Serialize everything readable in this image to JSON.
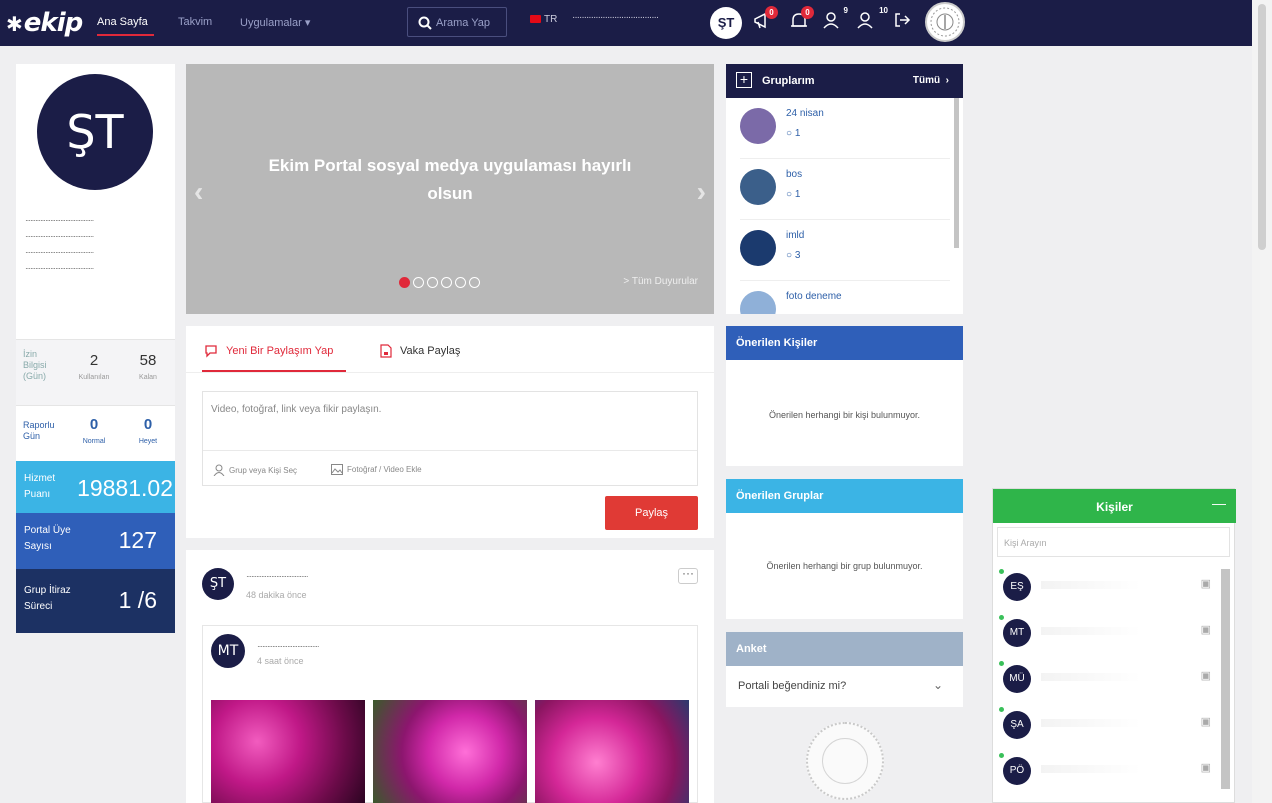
{
  "app": {
    "logo": "ekip"
  },
  "nav": {
    "home": "Ana Sayfa",
    "calendar": "Takvim",
    "apps": "Uygulamalar",
    "search_label": "Arama Yap",
    "lang": "TR",
    "user_masked": "·····································",
    "user_initials": "ŞT",
    "badges": {
      "announcements": "0",
      "notifications": "0",
      "friend_requests": "9",
      "group_requests": "10"
    }
  },
  "profile": {
    "initials": "ŞT",
    "masked_lines": [
      "·········································",
      "·········································",
      "·········································",
      "·········································"
    ],
    "leave": {
      "label": "İzin Bilgisi (Gün)",
      "used_value": "2",
      "used_label": "Kullanılan",
      "remaining_value": "58",
      "remaining_label": "Kalan"
    },
    "report": {
      "label": "Raporlu Gün",
      "normal_value": "0",
      "normal_label": "Normal",
      "committee_value": "0",
      "committee_label": "Heyet"
    },
    "service": {
      "label": "Hizmet Puanı",
      "value": "19881.02"
    },
    "members": {
      "label": "Portal Üye Sayısı",
      "value": "127"
    },
    "objection": {
      "label": "Grup İtiraz Süreci",
      "value": "1 /6"
    }
  },
  "slider": {
    "title": "Ekim Portal sosyal medya uygulaması hayırlı olsun",
    "all_link": "> Tüm Duyurular",
    "dot_count": 6,
    "active_dot": 0
  },
  "composer": {
    "tab_new": "Yeni Bir Paylaşım Yap",
    "tab_case": "Vaka Paylaş",
    "placeholder": "Video, fotoğraf, link veya fikir paylaşın.",
    "select_group": "Grup veya Kişi Seç",
    "add_media": "Fotoğraf / Video Ekle",
    "share": "Paylaş"
  },
  "feed": {
    "post": {
      "initials": "ŞT",
      "name_masked": "·····································",
      "time": "48 dakika önce",
      "more": "···"
    },
    "shared": {
      "initials": "MT",
      "name_masked": "·····································",
      "time": "4 saat önce"
    }
  },
  "groups": {
    "title": "Gruplarım",
    "all": "Tümü",
    "items": [
      {
        "name": "24 nisan",
        "count": "1",
        "color": "#7b6aa8"
      },
      {
        "name": "bos",
        "count": "1",
        "color": "#3b5f8a"
      },
      {
        "name": "imld",
        "count": "3",
        "color": "#1b3a6e"
      },
      {
        "name": "foto deneme",
        "count": "",
        "color": "#8fb0d8"
      }
    ]
  },
  "suggested_people": {
    "title": "Önerilen Kişiler",
    "empty": "Önerilen herhangi bir kişi bulunmuyor.",
    "color": "#2f5fb9"
  },
  "suggested_groups": {
    "title": "Önerilen Gruplar",
    "empty": "Önerilen herhangi bir grup bulunmuyor.",
    "color": "#3bb4e5"
  },
  "poll": {
    "title": "Anket",
    "question": "Portali beğendiniz mi?",
    "color": "#9fb2c8"
  },
  "contacts": {
    "title": "Kişiler",
    "minimize": "—",
    "search_placeholder": "Kişi Arayın",
    "items": [
      {
        "initials": "EŞ"
      },
      {
        "initials": "MT"
      },
      {
        "initials": "MÜ"
      },
      {
        "initials": "ŞA"
      },
      {
        "initials": "PÖ"
      }
    ]
  },
  "colors": {
    "navy": "#1b1d47",
    "accent_red": "#e0293a",
    "green": "#2fb54a"
  }
}
